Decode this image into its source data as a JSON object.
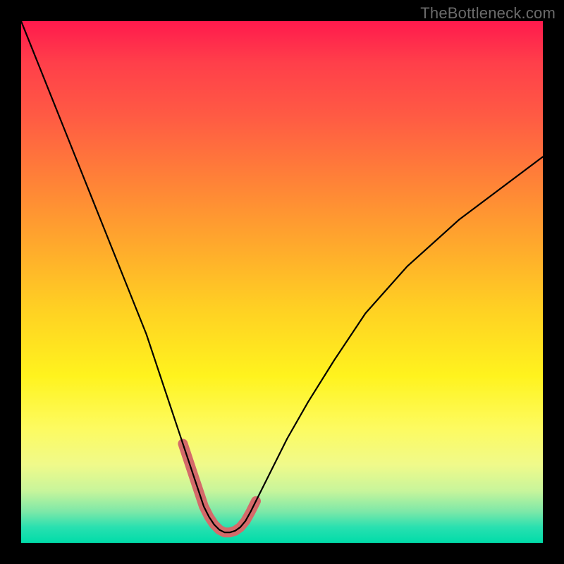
{
  "watermark": "TheBottleneck.com",
  "chart_data": {
    "type": "line",
    "title": "",
    "xlabel": "",
    "ylabel": "",
    "xlim": [
      0,
      100
    ],
    "ylim": [
      0,
      100
    ],
    "series": [
      {
        "name": "bottleneck-curve",
        "x": [
          0,
          4,
          8,
          12,
          16,
          20,
          24,
          27,
          29,
          31,
          33,
          34,
          35,
          36,
          37,
          38,
          39,
          40,
          41,
          42,
          43,
          44,
          45,
          46,
          48,
          51,
          55,
          60,
          66,
          74,
          84,
          100
        ],
        "y": [
          100,
          90,
          80,
          70,
          60,
          50,
          40,
          31,
          25,
          19,
          13,
          10,
          7,
          5,
          3.5,
          2.5,
          2,
          2,
          2.3,
          3,
          4.2,
          6,
          8,
          10,
          14,
          20,
          27,
          35,
          44,
          53,
          62,
          74
        ]
      }
    ],
    "highlight": {
      "name": "optimal-zone",
      "x": [
        31,
        32,
        33,
        34,
        35,
        36,
        37,
        38,
        39,
        40,
        41,
        42,
        43,
        44,
        45
      ],
      "y": [
        19,
        16,
        13,
        10,
        7,
        5,
        3.5,
        2.5,
        2,
        2,
        2.3,
        3,
        4.2,
        6,
        8
      ]
    },
    "colors": {
      "curve": "#000000",
      "highlight": "#d46a6a",
      "background_top": "#ff1a4d",
      "background_bottom": "#00dca9"
    }
  }
}
